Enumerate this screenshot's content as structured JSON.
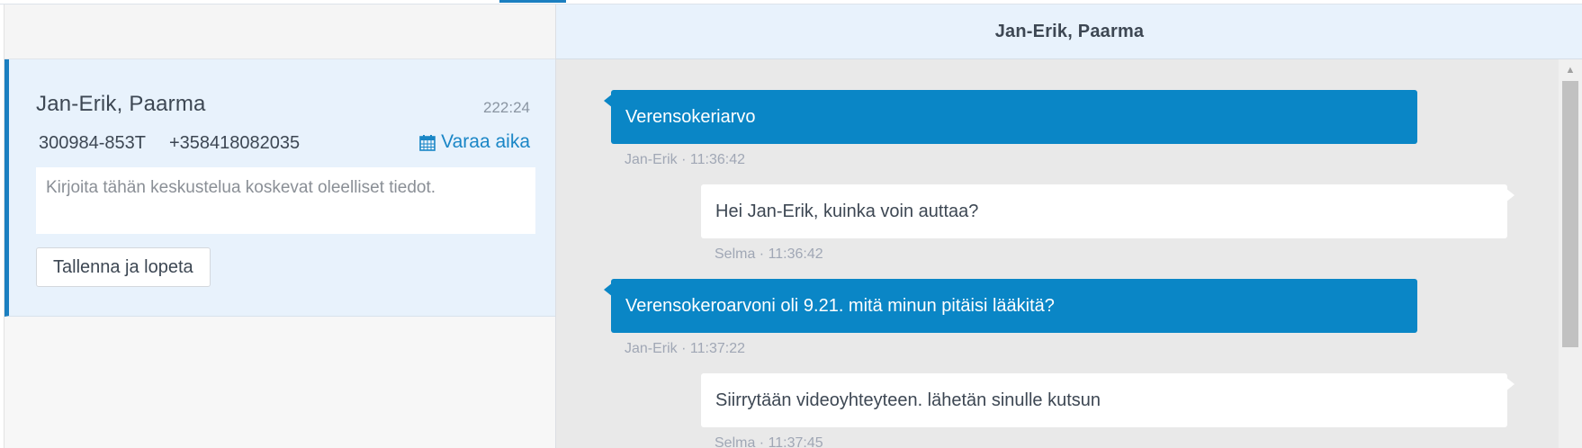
{
  "conversation_card": {
    "name": "Jan-Erik, Paarma",
    "elapsed_time": "222:24",
    "patient_id": "300984-853T",
    "phone": "+358418082035",
    "book_label": "Varaa aika",
    "notes_placeholder": "Kirjoita tähän keskustelua koskevat oleelliset tiedot.",
    "save_label": "Tallenna ja lopeta"
  },
  "chat": {
    "header_title": "Jan-Erik, Paarma",
    "messages": [
      {
        "direction": "incoming",
        "text": "Verensokeriarvo",
        "meta": "Jan-Erik · 11:36:42"
      },
      {
        "direction": "outgoing",
        "text": "Hei Jan-Erik, kuinka voin auttaa?",
        "meta": "Selma · 11:36:42"
      },
      {
        "direction": "incoming",
        "text": "Verensokeroarvoni oli 9.21. mitä minun pitäisi lääkitä?",
        "meta": "Jan-Erik · 11:37:22"
      },
      {
        "direction": "outgoing",
        "text": "Siirrytään videoyhteyteen. lähetän sinulle kutsun",
        "meta": "Selma · 11:37:45"
      }
    ]
  },
  "icons": {
    "calendar": "calendar-icon",
    "scroll_up": "scroll-up-arrow-icon"
  },
  "colors": {
    "accent": "#1b7fc0",
    "incoming_bubble": "#0a86c6",
    "outgoing_bubble": "#ffffff",
    "card_background": "#e8f2fc",
    "chat_background": "#e9e9e9"
  }
}
